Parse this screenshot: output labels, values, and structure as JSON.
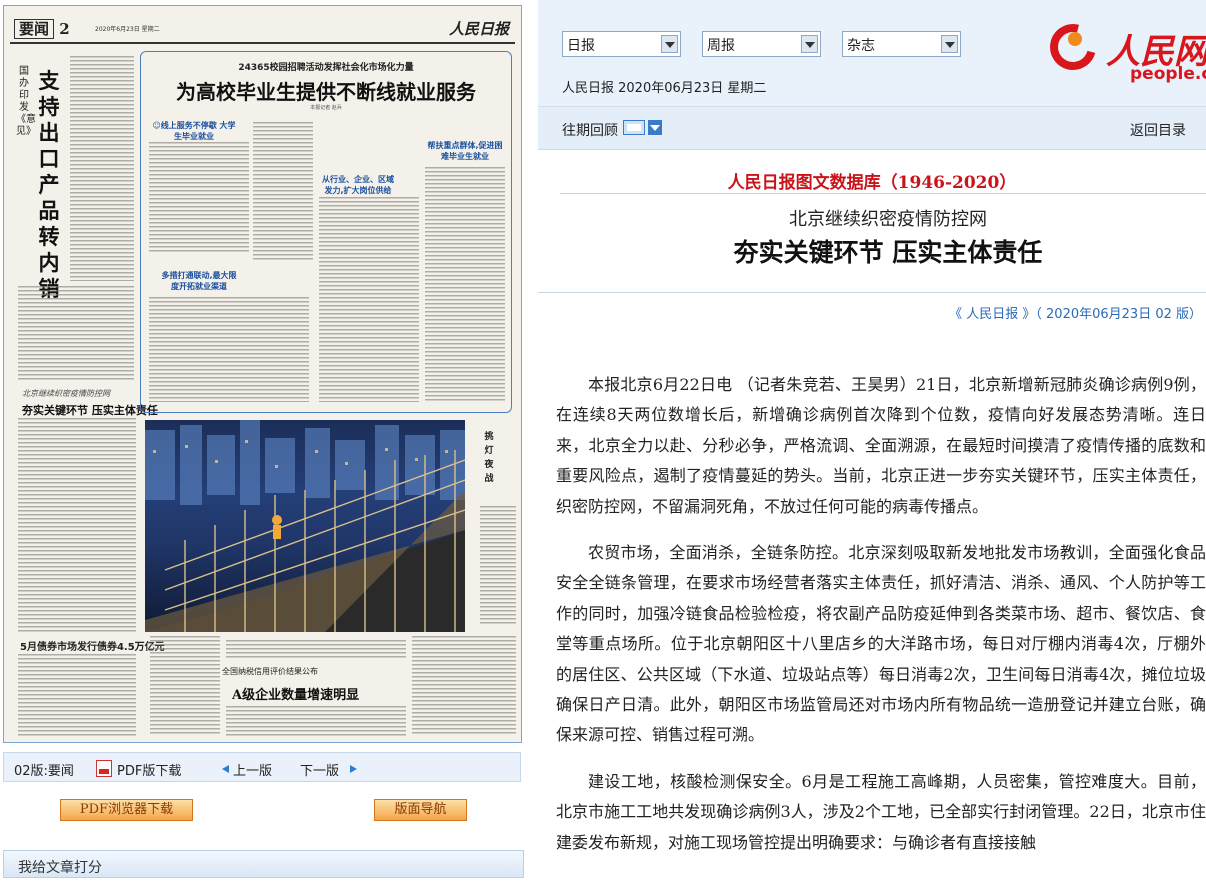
{
  "newspaper": {
    "section": "要闻",
    "page_no": "2",
    "date": "2020年6月23日 星期二",
    "masthead": "人民日报",
    "vertical_kicker": "国办印发《意见》",
    "vertical_headline": "支持出口产品转内销",
    "box_kicker": "24365校园招聘活动发挥社会化市场化力量",
    "box_title": "为高校毕业生提供不断线就业服务",
    "box_byline": "本报记者  赵兵",
    "box_subhead_1": "☺线上服务不停歇 大学生毕业就业",
    "box_subhead_2": "从行业、企业、区域发力,扩大岗位供给",
    "box_subhead_3": "多措打通联动,最大限度开拓就业渠道",
    "box_subhead_4": "帮扶重点群体,促进困难毕业生就业",
    "left_small_title": "北京继续织密疫情防控网",
    "left_title": "夯实关键环节 压实主体责任",
    "photo_side_title": "挑灯夜战",
    "bottom_left_title": "5月债券市场发行债券4.5万亿元",
    "bottom_kicker": "全国纳税信用评价结果公布",
    "bottom_title": "A级企业数量增速明显"
  },
  "page_nav": {
    "current": "02版:要闻",
    "pdf": "PDF版下载",
    "prev": "上一版",
    "next": "下一版"
  },
  "buttons": {
    "pdf_browser": "PDF浏览器下载",
    "layout_nav": "版面导航"
  },
  "rate": {
    "label": "我给文章打分"
  },
  "selectors": {
    "daily": "日报",
    "weekly": "周报",
    "magazine": "杂志"
  },
  "date_line": "人民日报 2020年06月23日 星期二",
  "logo": {
    "cn": "人民网",
    "en": "people.cn"
  },
  "nav": {
    "past": "往期回顾",
    "back": "返回目录"
  },
  "db_title": "人民日报图文数据库（1946-2020）",
  "article": {
    "subtitle": "北京继续织密疫情防控网",
    "headline": "夯实关键环节 压实主体责任",
    "source": "《 人民日报 》（ 2020年06月23日   02 版）",
    "paragraphs": [
      "本报北京6月22日电 （记者朱竞若、王昊男）21日，北京新增新冠肺炎确诊病例9例，在连续8天两位数增长后，新增确诊病例首次降到个位数，疫情向好发展态势清晰。连日来，北京全力以赴、分秒必争，严格流调、全面溯源，在最短时间摸清了疫情传播的底数和重要风险点，遏制了疫情蔓延的势头。当前，北京正进一步夯实关键环节，压实主体责任，织密防控网，不留漏洞死角，不放过任何可能的病毒传播点。",
      "农贸市场，全面消杀，全链条防控。北京深刻吸取新发地批发市场教训，全面强化食品安全全链条管理，在要求市场经营者落实主体责任，抓好清洁、消杀、通风、个人防护等工作的同时，加强冷链食品检验检疫，将农副产品防疫延伸到各类菜市场、超市、餐饮店、食堂等重点场所。位于北京朝阳区十八里店乡的大洋路市场，每日对厅棚内消毒4次，厅棚外的居住区、公共区域（下水道、垃圾站点等）每日消毒2次，卫生间每日消毒4次，摊位垃圾确保日产日清。此外，朝阳区市场监管局还对市场内所有物品统一造册登记并建立台账，确保来源可控、销售过程可溯。",
      "建设工地，核酸检测保安全。6月是工程施工高峰期，人员密集，管控难度大。目前，北京市施工工地共发现确诊病例3人，涉及2个工地，已全部实行封闭管理。22日，北京市住建委发布新规，对施工现场管控提出明确要求：与确诊者有直接接触"
    ]
  }
}
